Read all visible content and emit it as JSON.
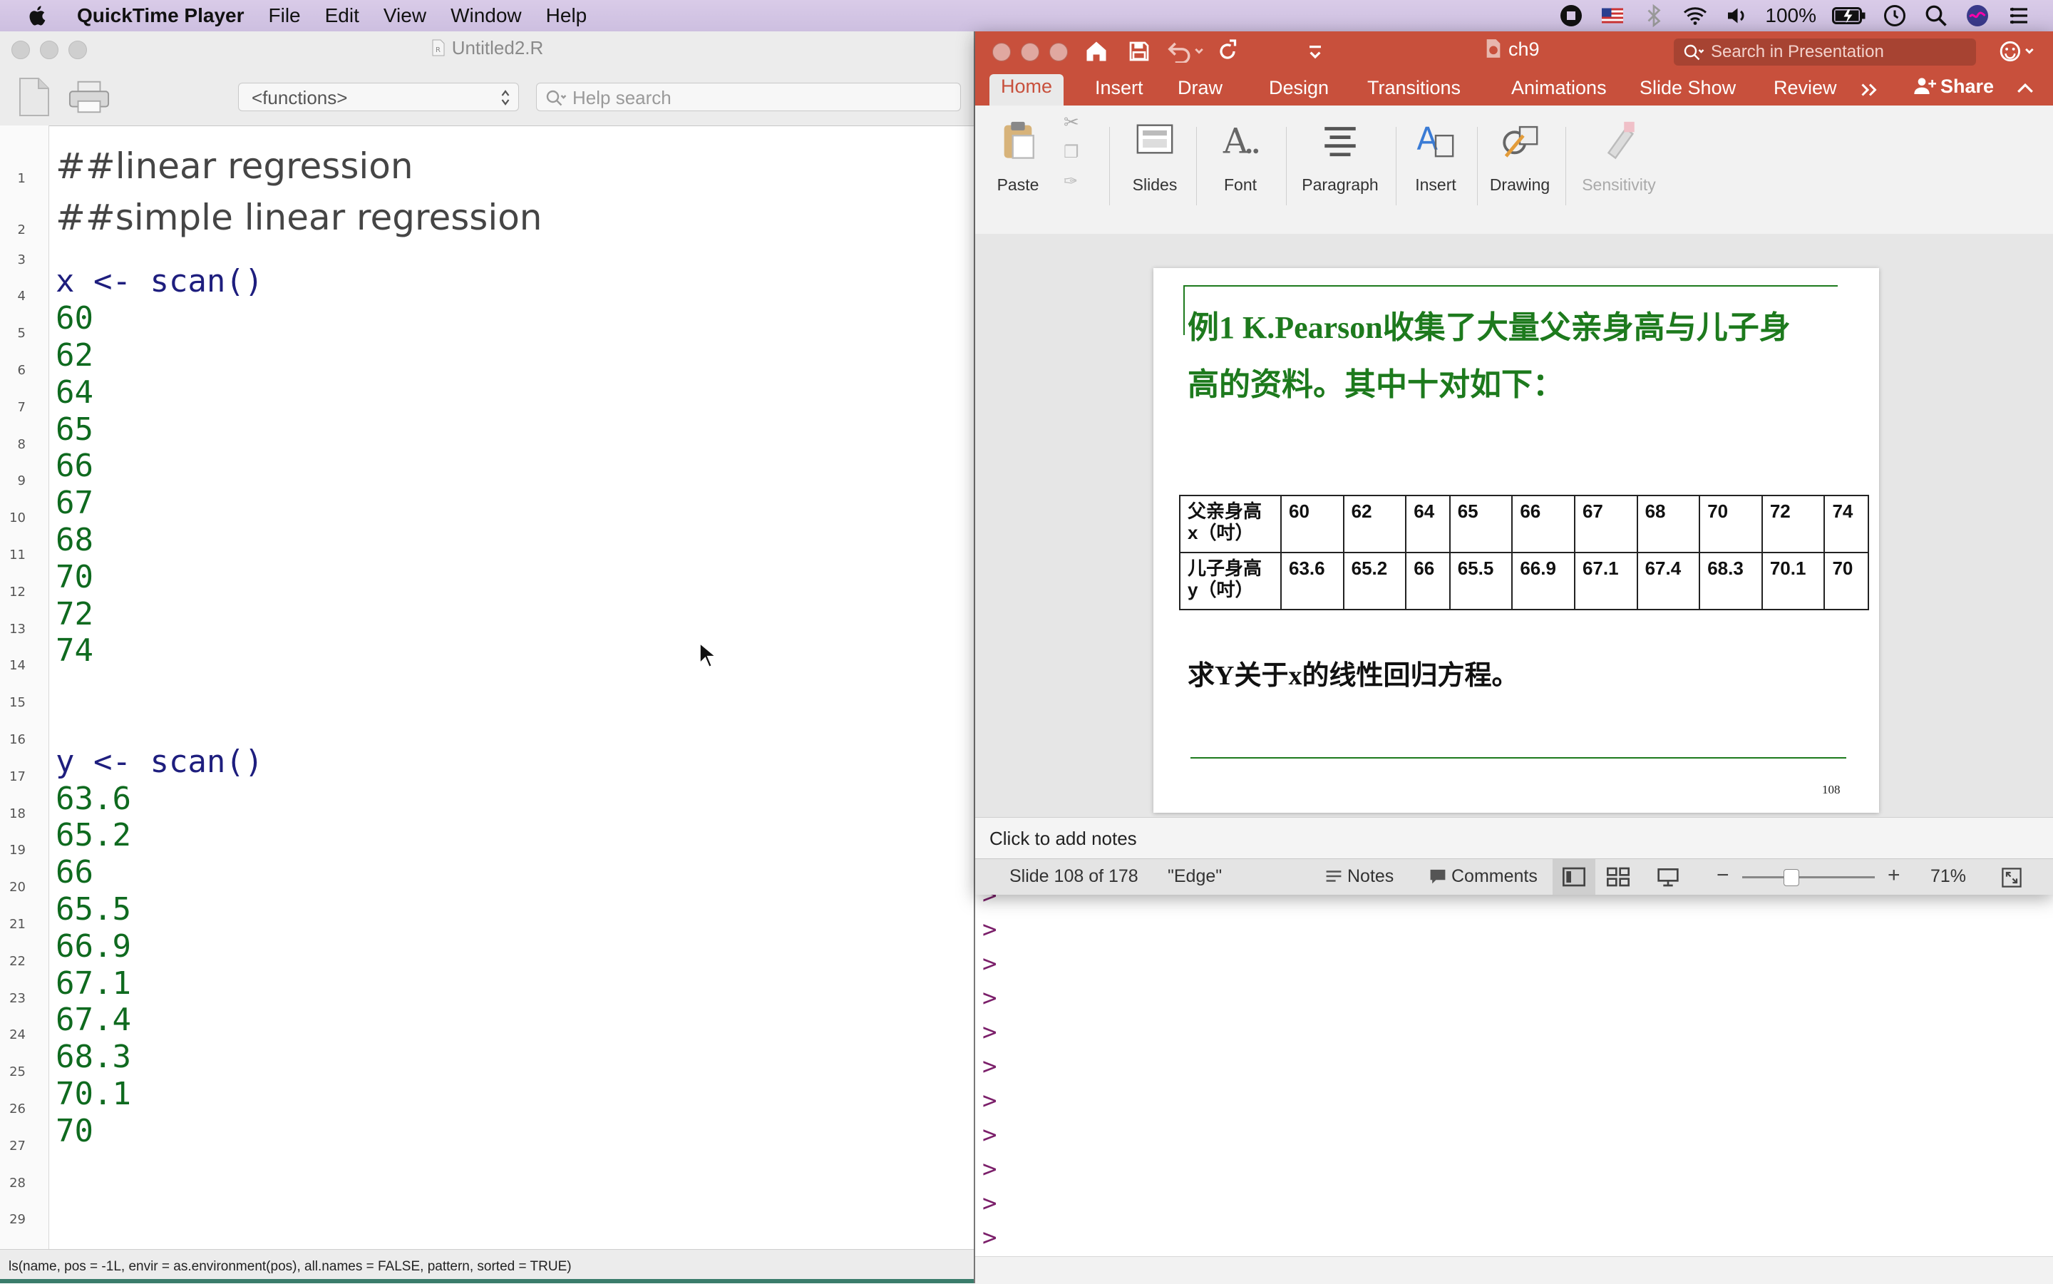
{
  "menubar": {
    "app_name": "QuickTime Player",
    "items": [
      "File",
      "Edit",
      "View",
      "Window",
      "Help"
    ],
    "battery": "100%"
  },
  "r_editor": {
    "title": "Untitled2.R",
    "functions_placeholder": "<functions>",
    "help_placeholder": "Help search",
    "lines": [
      {
        "n": "1",
        "text": "##linear regression",
        "kind": "comment"
      },
      {
        "n": "2",
        "text": "##simple linear regression",
        "kind": "comment"
      },
      {
        "n": "3",
        "text": "",
        "kind": "blank"
      },
      {
        "n": "4",
        "text": "x <- scan()",
        "kind": "cmd"
      },
      {
        "n": "5",
        "text": "60",
        "kind": "num"
      },
      {
        "n": "6",
        "text": "62",
        "kind": "num"
      },
      {
        "n": "7",
        "text": "64",
        "kind": "num"
      },
      {
        "n": "8",
        "text": "65",
        "kind": "num"
      },
      {
        "n": "9",
        "text": "66",
        "kind": "num"
      },
      {
        "n": "10",
        "text": "67",
        "kind": "num"
      },
      {
        "n": "11",
        "text": "68",
        "kind": "num"
      },
      {
        "n": "12",
        "text": "70",
        "kind": "num"
      },
      {
        "n": "13",
        "text": "72",
        "kind": "num"
      },
      {
        "n": "14",
        "text": "74",
        "kind": "num"
      },
      {
        "n": "15",
        "text": "",
        "kind": "blank"
      },
      {
        "n": "16",
        "text": "",
        "kind": "blank"
      },
      {
        "n": "17",
        "text": "y <- scan()",
        "kind": "cmd"
      },
      {
        "n": "18",
        "text": "63.6",
        "kind": "num"
      },
      {
        "n": "19",
        "text": "65.2",
        "kind": "num"
      },
      {
        "n": "20",
        "text": "66",
        "kind": "num"
      },
      {
        "n": "21",
        "text": "65.5",
        "kind": "num"
      },
      {
        "n": "22",
        "text": "66.9",
        "kind": "num"
      },
      {
        "n": "23",
        "text": "67.1",
        "kind": "num"
      },
      {
        "n": "24",
        "text": "67.4",
        "kind": "num"
      },
      {
        "n": "25",
        "text": "68.3",
        "kind": "num"
      },
      {
        "n": "26",
        "text": "70.1",
        "kind": "num"
      },
      {
        "n": "27",
        "text": "70",
        "kind": "num"
      },
      {
        "n": "28",
        "text": "",
        "kind": "blank"
      },
      {
        "n": "29",
        "text": "",
        "kind": "blank"
      }
    ],
    "status": "ls(name, pos = -1L, envir = as.environment(pos), all.names = FALSE, pattern, sorted = TRUE)"
  },
  "console": {
    "prompt": ">"
  },
  "ppt": {
    "doc_title": "ch9",
    "search_placeholder": "Search in Presentation",
    "tabs": [
      "Home",
      "Insert",
      "Draw",
      "Design",
      "Transitions",
      "Animations",
      "Slide Show",
      "Review"
    ],
    "share": "Share",
    "ribbon": {
      "paste": "Paste",
      "slides": "Slides",
      "font": "Font",
      "paragraph": "Paragraph",
      "insert": "Insert",
      "drawing": "Drawing",
      "sensitivity": "Sensitivity"
    },
    "slide": {
      "heading_line1": "例1  K.Pearson收集了大量父亲身高与儿子身",
      "heading_line2": "高的资料。其中十对如下：",
      "row1_label_a": "父亲身高",
      "row1_label_b": "x（吋）",
      "row1_values": [
        "60",
        "62",
        "64",
        "65",
        "66",
        "67",
        "68",
        "70",
        "72",
        "74"
      ],
      "row2_label_a": "儿子身高",
      "row2_label_b": "y（吋）",
      "row2_values": [
        "63.6",
        "65.2",
        "66",
        "65.5",
        "66.9",
        "67.1",
        "67.4",
        "68.3",
        "70.1",
        "70"
      ],
      "question": "求Y关于x的线性回归方程。",
      "page_number": "108"
    },
    "notes_placeholder": "Click to add notes",
    "status": {
      "slide_info": "Slide 108 of 178",
      "theme": "\"Edge\"",
      "notes": "Notes",
      "comments": "Comments",
      "zoom": "71%"
    }
  }
}
